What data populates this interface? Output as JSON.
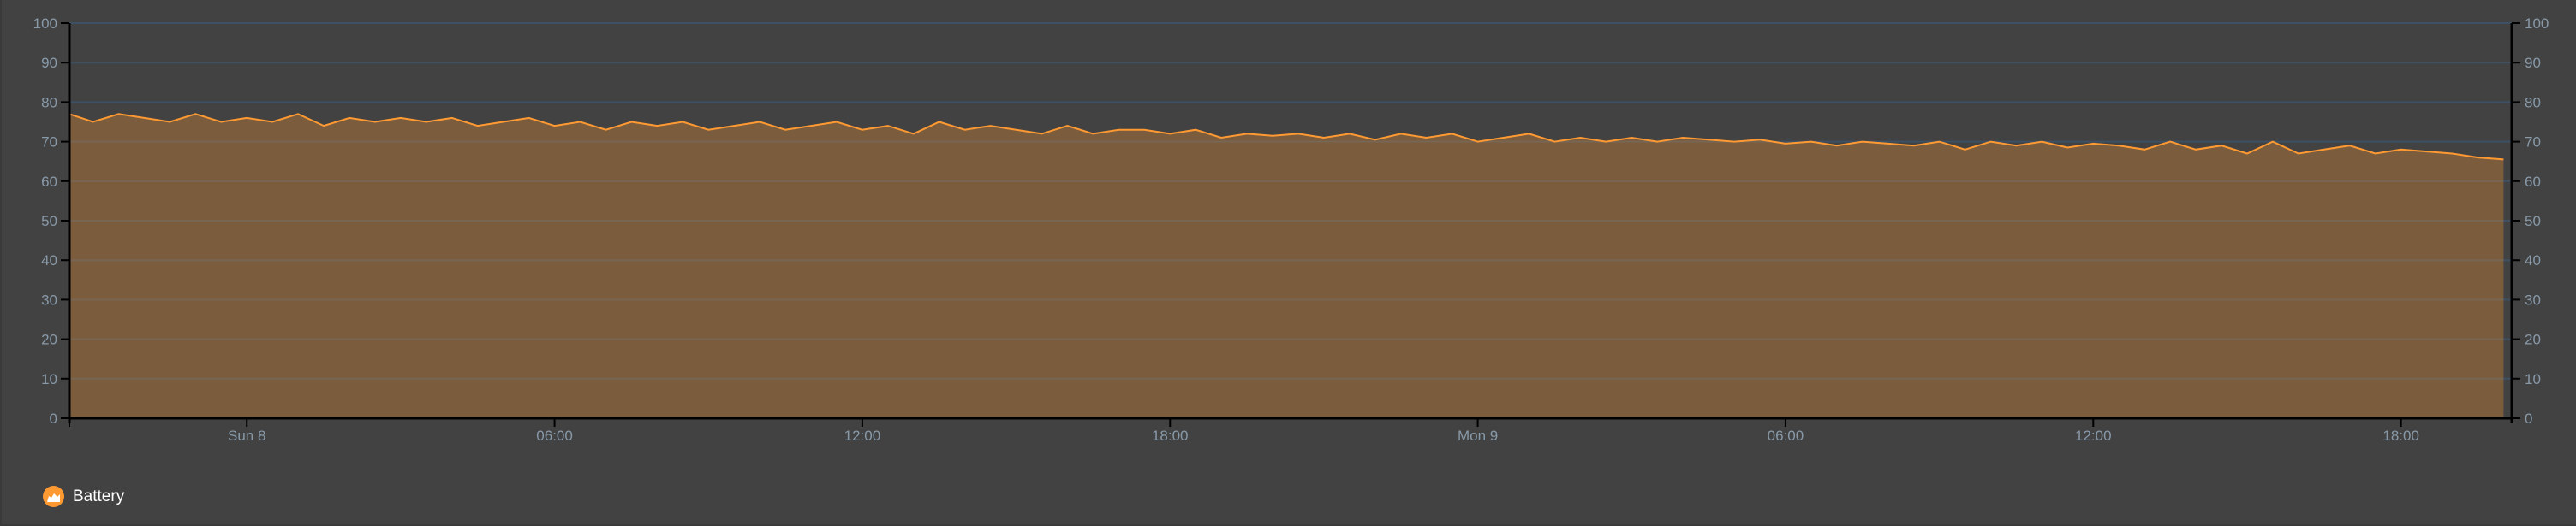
{
  "chart_data": {
    "type": "area",
    "title": "",
    "xlabel": "",
    "ylabel": "",
    "ylim": [
      0,
      100
    ],
    "y_ticks": [
      "0",
      "10",
      "20",
      "30",
      "40",
      "50",
      "60",
      "70",
      "80",
      "90",
      "100"
    ],
    "y_axis_sides": [
      "left",
      "right"
    ],
    "x_unit": "hours since Sun 8 00:00",
    "xlim": [
      -3.46,
      44.16
    ],
    "x_ticks": [
      {
        "label": "Sun 8",
        "x": 0
      },
      {
        "label": "06:00",
        "x": 6
      },
      {
        "label": "12:00",
        "x": 12
      },
      {
        "label": "18:00",
        "x": 18
      },
      {
        "label": "Mon 9",
        "x": 24
      },
      {
        "label": "06:00",
        "x": 30
      },
      {
        "label": "12:00",
        "x": 36
      },
      {
        "label": "18:00",
        "x": 42
      }
    ],
    "grid": true,
    "legend_position": "bottom-left",
    "series": [
      {
        "name": "Battery",
        "color": "#ff9a33",
        "x_start": -3.5,
        "x_step": 0.5,
        "values": [
          77,
          75,
          77,
          76,
          75,
          77,
          75,
          76,
          75,
          77,
          74,
          76,
          75,
          76,
          75,
          76,
          74,
          75,
          76,
          74,
          75,
          73,
          75,
          74,
          75,
          73,
          74,
          75,
          73,
          74,
          75,
          73,
          74,
          72,
          75,
          73,
          74,
          73,
          72,
          74,
          72,
          73,
          73,
          72,
          73,
          71,
          72,
          71.5,
          72,
          71,
          72,
          70.5,
          72,
          71,
          72,
          70,
          71,
          72,
          70,
          71,
          70,
          71,
          70,
          71,
          70.5,
          70,
          70.5,
          69.5,
          70,
          69,
          70,
          69.5,
          69,
          70,
          68,
          70,
          69,
          70,
          68.5,
          69.5,
          69,
          68,
          70,
          68,
          69,
          67,
          70,
          67,
          68,
          69,
          67,
          68,
          67.5,
          67,
          66,
          65.5
        ]
      }
    ]
  },
  "legend": {
    "items": [
      {
        "label": "Battery",
        "icon": "area-chart-icon"
      }
    ]
  },
  "colors": {
    "background": "#424242",
    "grid": "#3e5064",
    "axis": "#000000",
    "line": "#ff9a33"
  }
}
